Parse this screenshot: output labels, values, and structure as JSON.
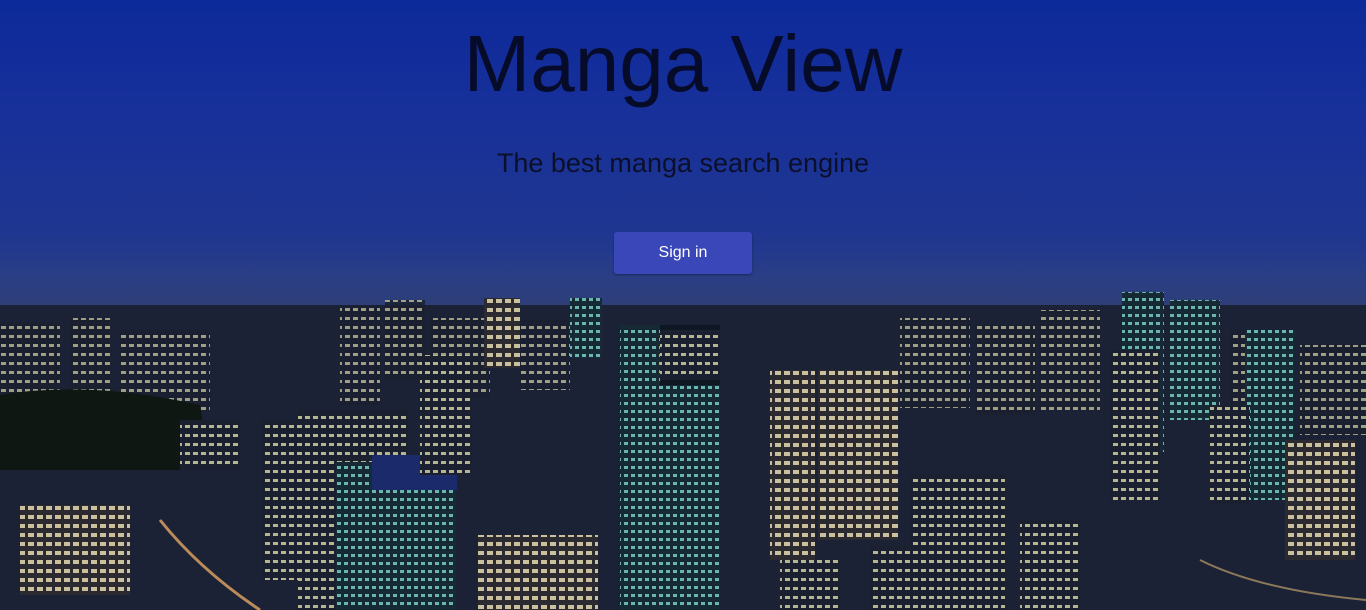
{
  "hero": {
    "title": "Manga View",
    "subtitle": "The best manga search engine",
    "signin_label": "Sign in"
  },
  "colors": {
    "sky_top": "#0d2a9a",
    "title": "#070b2a",
    "button_bg": "#3a47b8",
    "button_text": "#ffffff"
  },
  "background": {
    "scene": "night-city-skyline"
  }
}
